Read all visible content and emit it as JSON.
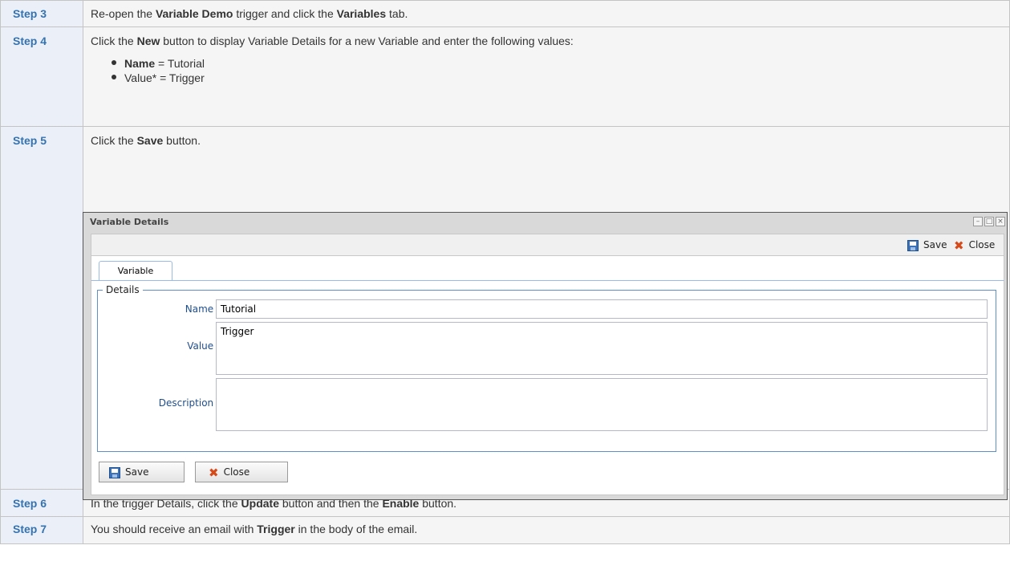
{
  "steps": [
    {
      "label": "Step 3",
      "parts": [
        "Re-open the ",
        "Variable Demo",
        " trigger and click the ",
        "Variables",
        " tab."
      ]
    },
    {
      "label": "Step 4",
      "parts": [
        "Click the ",
        "New",
        " button to display Variable Details for a new Variable and enter the following values:"
      ],
      "values": [
        {
          "name": "Name",
          "rest": " = Tutorial"
        },
        {
          "name": "",
          "rest": "Value* = Trigger"
        }
      ]
    },
    {
      "label": "Step 5",
      "parts": [
        "Click the ",
        "Save",
        " button."
      ]
    },
    {
      "label": "Step 6",
      "parts": [
        "In the trigger Details, click the ",
        "Update",
        " button and then the ",
        "Enable",
        " button."
      ]
    },
    {
      "label": "Step 7",
      "parts": [
        "You should receive an email with ",
        "Trigger",
        " in the body of the email."
      ]
    }
  ],
  "dialog": {
    "title": "Variable Details",
    "window_controls": {
      "minimize": "–",
      "maximize": "□",
      "close": "×"
    },
    "toolbar": {
      "save": "Save",
      "close": "Close"
    },
    "tab": "Variable",
    "fieldset_legend": "Details",
    "fields": {
      "name_label": "Name :",
      "name_value": "Tutorial",
      "value_label": "Value :",
      "value_value": "Trigger",
      "description_label": "Description :",
      "description_value": ""
    },
    "buttons": {
      "save": "Save",
      "close": "Close"
    },
    "icons": {
      "save": "floppy-disk-icon",
      "close": "red-x-icon"
    }
  }
}
